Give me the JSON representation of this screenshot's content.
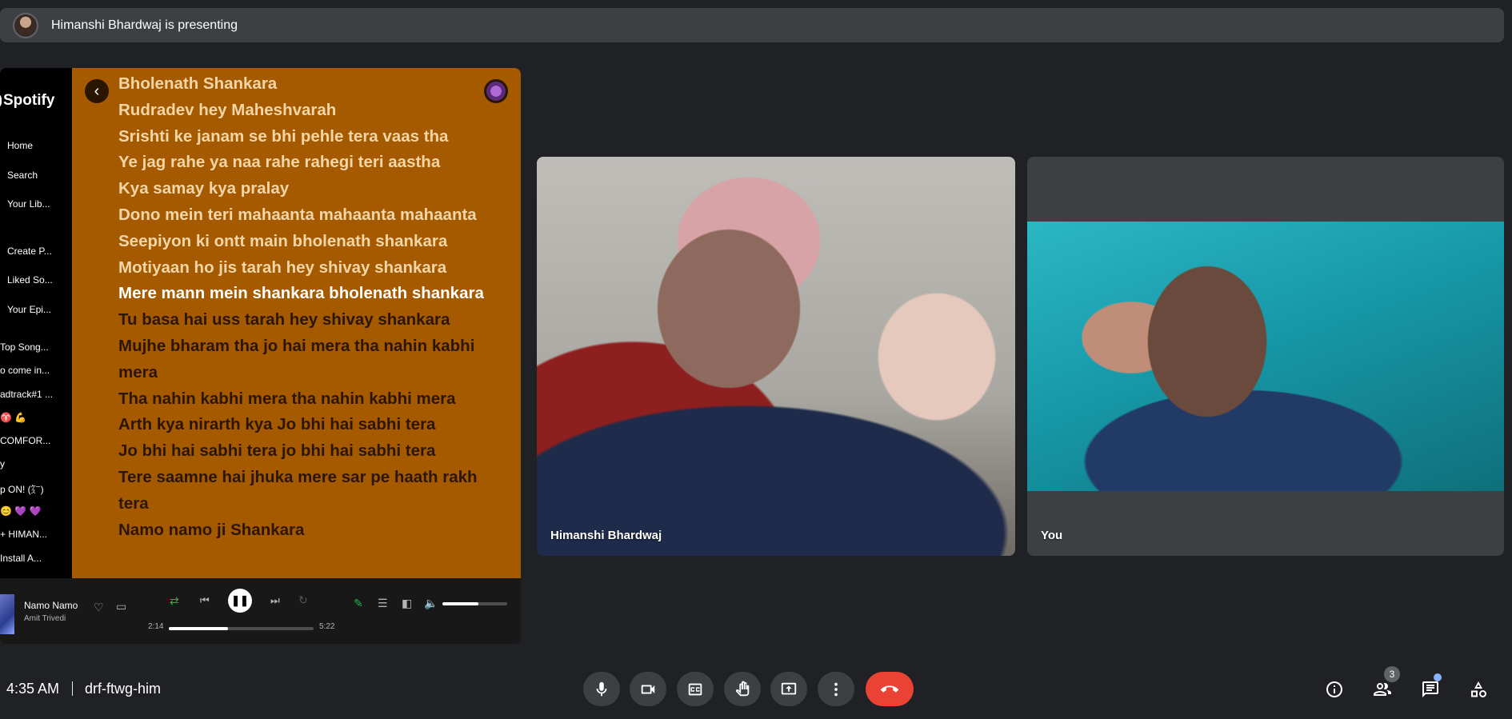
{
  "presenting": {
    "text": "Himanshi Bhardwaj is presenting"
  },
  "spotify": {
    "logo": "Spotify",
    "nav": [
      "Home",
      "Search",
      "Your Lib...",
      "Create P...",
      "Liked So...",
      "Your Epi..."
    ],
    "playlists": [
      "Top Song...",
      "o come in...",
      "adtrack#1 ...",
      "♈ 💪",
      "COMFOR...",
      "y",
      "p ON! (㌜)",
      "😊 💜 💜",
      "+ HIMAN...",
      "Install A..."
    ],
    "lyrics": [
      {
        "text": "Bholenath Shankara",
        "state": "past"
      },
      {
        "text": "Rudradev hey Maheshvarah",
        "state": "past"
      },
      {
        "text": "Srishti ke janam se bhi pehle tera vaas tha",
        "state": "past"
      },
      {
        "text": "Ye jag rahe ya naa rahe rahegi teri aastha",
        "state": "past"
      },
      {
        "text": "Kya samay kya pralay",
        "state": "past"
      },
      {
        "text": "Dono mein teri mahaanta mahaanta mahaanta",
        "state": "past"
      },
      {
        "text": "Seepiyon ki ontt main bholenath shankara",
        "state": "past"
      },
      {
        "text": "Motiyaan ho jis tarah hey shivay shankara",
        "state": "past"
      },
      {
        "text": "Mere mann mein shankara bholenath shankara",
        "state": "active"
      },
      {
        "text": "Tu basa hai uss tarah hey shivay shankara",
        "state": "future"
      },
      {
        "text": "Mujhe bharam tha jo hai mera tha nahin kabhi mera",
        "state": "future"
      },
      {
        "text": "Tha nahin kabhi mera tha nahin kabhi mera",
        "state": "future"
      },
      {
        "text": "Arth kya nirarth kya Jo bhi hai sabhi tera",
        "state": "future"
      },
      {
        "text": "Jo bhi hai sabhi tera jo bhi hai sabhi tera",
        "state": "future"
      },
      {
        "text": "Tere saamne hai jhuka mere sar pe haath rakh tera",
        "state": "future"
      },
      {
        "text": "Namo namo ji Shankara",
        "state": "future"
      }
    ],
    "now_playing": {
      "title": "Namo Namo",
      "artist": "Amit Trivedi",
      "elapsed": "2:14",
      "duration": "5:22",
      "progress": 0.41,
      "volume": 0.55
    }
  },
  "participants": [
    {
      "name": "Himanshi Bhardwaj"
    },
    {
      "name": "You"
    }
  ],
  "bottom_bar": {
    "time": "4:35 AM",
    "meeting_code": "drf-ftwg-him",
    "people_count": "3"
  },
  "colors": {
    "background": "#202124",
    "lyrics_bg": "#a55a00",
    "end_call": "#ea4335",
    "spotify_green": "#1db954"
  }
}
